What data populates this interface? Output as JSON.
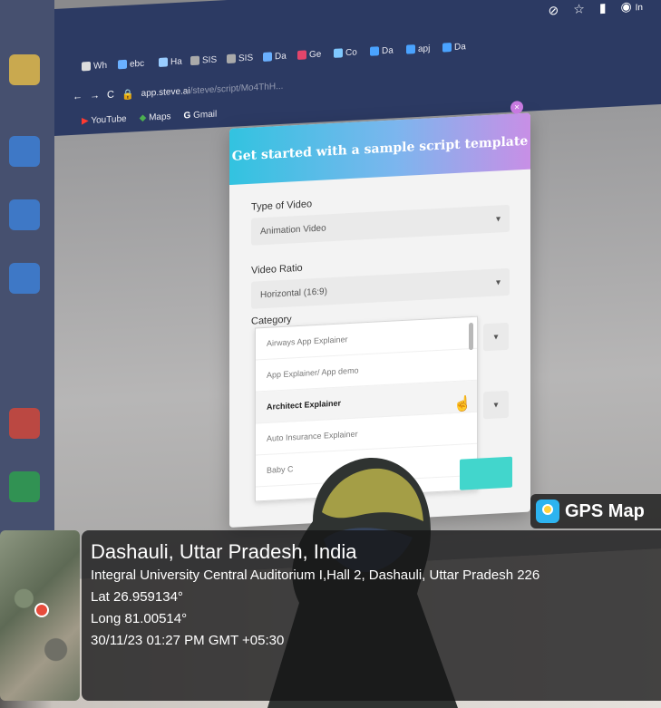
{
  "browser": {
    "tabs": [
      "Wh",
      "ebc",
      "Ha",
      "SIS",
      "SIS",
      "Da",
      "Ge",
      "Co",
      "Da",
      "apj",
      "Da"
    ],
    "url_host": "app.steve.ai",
    "url_path": "/steve/script/Mo4ThH...",
    "bookmarks": [
      "YouTube",
      "Maps",
      "Gmail"
    ],
    "profile_initial": "In"
  },
  "modal": {
    "title": "Get started with a sample script template",
    "close_glyph": "×",
    "type_of_video": {
      "label": "Type of Video",
      "value": "Animation Video"
    },
    "video_ratio": {
      "label": "Video Ratio",
      "value": "Horizontal (16:9)"
    },
    "category": {
      "label": "Category",
      "options": [
        "Airways App Explainer",
        "App Explainer/ App demo",
        "Architect Explainer",
        "Auto Insurance Explainer",
        "Baby C"
      ],
      "highlighted_index": 2
    }
  },
  "gps": {
    "brand": "GPS Map",
    "place": "Dashauli, Uttar Pradesh, India",
    "address": "Integral University Central Auditorium I,Hall 2, Dashauli, Uttar Pradesh 226",
    "lat": "Lat 26.959134°",
    "long": "Long 81.00514°",
    "datetime": "30/11/23 01:27 PM GMT +05:30"
  },
  "colors": {
    "modal_header_start": "#32c3e0",
    "modal_header_end": "#c88fe6",
    "accent_button": "#42d6cc",
    "gps_panel": "#141416"
  }
}
